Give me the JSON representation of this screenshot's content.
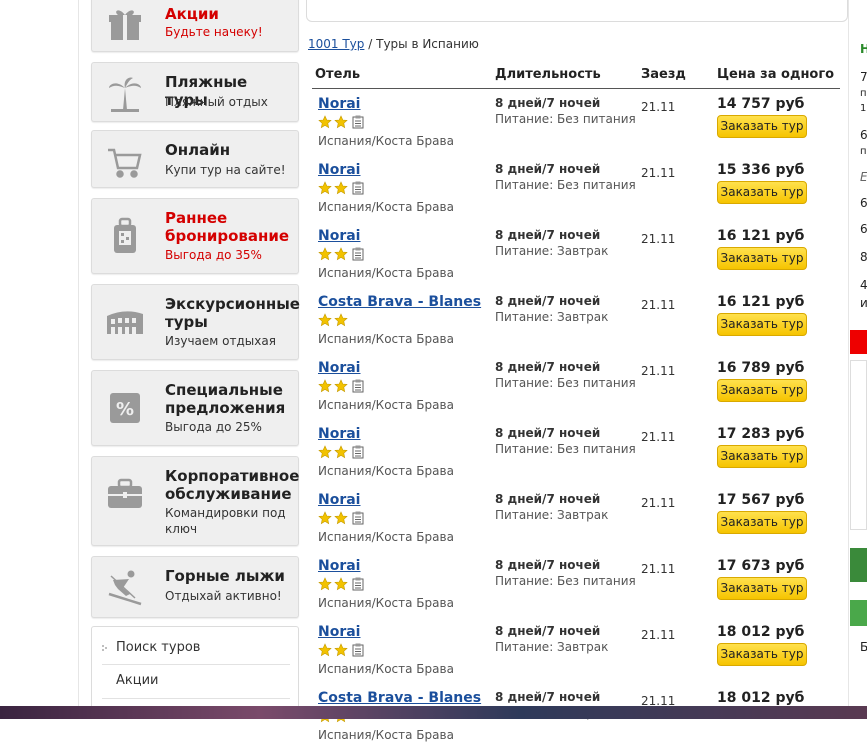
{
  "sidebar": {
    "tiles": [
      {
        "title": "Акции",
        "subtitle": "Будьте начеку!",
        "icon": "gift-icon",
        "title_red": true,
        "sub_red": true
      },
      {
        "title": "Пляжные туры",
        "subtitle": "Пляжный отдых",
        "icon": "palm-tree-icon"
      },
      {
        "title": "Онлайн",
        "subtitle": "Купи тур на сайте!",
        "icon": "cart-icon"
      },
      {
        "title": "Раннее бронирование",
        "subtitle": "Выгода до 35%",
        "icon": "suitcase-icon",
        "title_red": true,
        "sub_red": true
      },
      {
        "title": "Экскурсионные туры",
        "subtitle": "Изучаем отдыхая",
        "icon": "colosseum-icon"
      },
      {
        "title": "Специальные предложения",
        "subtitle": "Выгода до 25%",
        "icon": "percent-icon"
      },
      {
        "title": "Корпоративное обслуживание",
        "subtitle": "Командировки под ключ",
        "icon": "briefcase-icon"
      },
      {
        "title": "Горные лыжи",
        "subtitle": "Отдыхай активно!",
        "icon": "skier-icon"
      }
    ],
    "menu": [
      "Поиск туров",
      "Акции"
    ]
  },
  "breadcrumb": {
    "link": "1001 Тур",
    "sep": "/",
    "current": "Туры в Испанию"
  },
  "table": {
    "headers": {
      "hotel": "Отель",
      "duration": "Длительность",
      "checkin": "Заезд",
      "price": "Цена за одного"
    },
    "book_label": "Заказать тур",
    "rows": [
      {
        "hotel": "Norai",
        "stars": 2,
        "doc": true,
        "loc": "Испания/Коста Брава",
        "dur": "8 дней/7 ночей",
        "meal": "Питание: Без питания",
        "date": "21.11",
        "price": "14 757 руб"
      },
      {
        "hotel": "Norai",
        "stars": 2,
        "doc": true,
        "loc": "Испания/Коста Брава",
        "dur": "8 дней/7 ночей",
        "meal": "Питание: Без питания",
        "date": "21.11",
        "price": "15 336 руб"
      },
      {
        "hotel": "Norai",
        "stars": 2,
        "doc": true,
        "loc": "Испания/Коста Брава",
        "dur": "8 дней/7 ночей",
        "meal": "Питание: Завтрак",
        "date": "21.11",
        "price": "16 121 руб"
      },
      {
        "hotel": "Costa Brava - Blanes",
        "stars": 2,
        "doc": false,
        "loc": "Испания/Коста Брава",
        "dur": "8 дней/7 ночей",
        "meal": "Питание: Завтрак",
        "date": "21.11",
        "price": "16 121 руб"
      },
      {
        "hotel": "Norai",
        "stars": 2,
        "doc": true,
        "loc": "Испания/Коста Брава",
        "dur": "8 дней/7 ночей",
        "meal": "Питание: Без питания",
        "date": "21.11",
        "price": "16 789 руб"
      },
      {
        "hotel": "Norai",
        "stars": 2,
        "doc": true,
        "loc": "Испания/Коста Брава",
        "dur": "8 дней/7 ночей",
        "meal": "Питание: Без питания",
        "date": "21.11",
        "price": "17 283 руб"
      },
      {
        "hotel": "Norai",
        "stars": 2,
        "doc": true,
        "loc": "Испания/Коста Брава",
        "dur": "8 дней/7 ночей",
        "meal": "Питание: Завтрак",
        "date": "21.11",
        "price": "17 567 руб"
      },
      {
        "hotel": "Norai",
        "stars": 2,
        "doc": true,
        "loc": "Испания/Коста Брава",
        "dur": "8 дней/7 ночей",
        "meal": "Питание: Без питания",
        "date": "21.11",
        "price": "17 673 руб"
      },
      {
        "hotel": "Norai",
        "stars": 2,
        "doc": true,
        "loc": "Испания/Коста Брава",
        "dur": "8 дней/7 ночей",
        "meal": "Питание: Завтрак",
        "date": "21.11",
        "price": "18 012 руб"
      },
      {
        "hotel": "Costa Brava - Blanes",
        "stars": 2,
        "doc": false,
        "loc": "Испания/Коста Брава",
        "dur": "8 дней/7 ночей",
        "meal": "Питание: Завтрак",
        "date": "21.11",
        "price": "18 012 руб"
      }
    ]
  },
  "right_column": {
    "fragments": [
      "Н",
      "7",
      "п",
      "1",
      "6",
      "п",
      "Е",
      "6",
      "6",
      "8",
      "4",
      "и",
      "Б"
    ]
  },
  "colors": {
    "accent_red": "#d40000",
    "link_blue": "#1b4f9c",
    "button_yellow": "#f6c400"
  }
}
